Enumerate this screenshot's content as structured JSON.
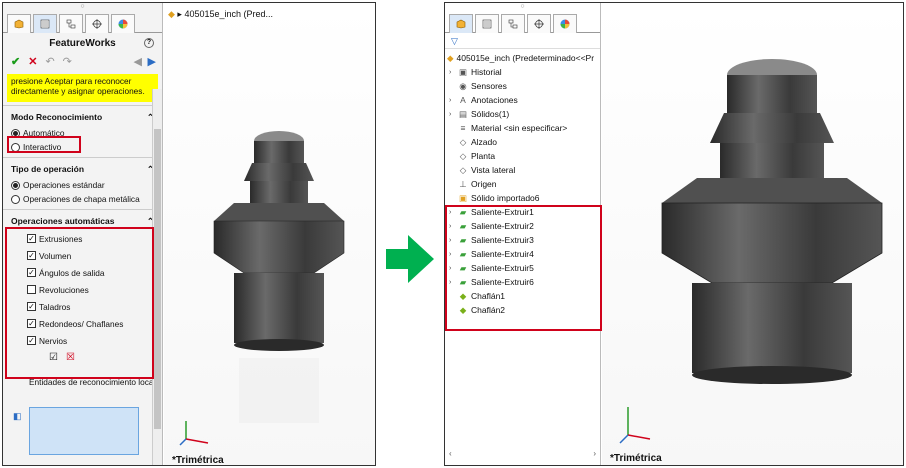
{
  "left": {
    "header_file": "405015e_inch  (Pred...",
    "feature_title": "FeatureWorks",
    "note_text": "presione Aceptar para reconocer directamente y asignar operaciones.",
    "recognition_mode": {
      "heading": "Modo Reconocimiento",
      "options": [
        "Automático",
        "Interactivo"
      ],
      "selected": "Automático"
    },
    "operation_type": {
      "heading": "Tipo de operación",
      "options": [
        "Operaciones estándar",
        "Operaciones de chapa metálica"
      ],
      "selected": "Operaciones estándar"
    },
    "auto_ops": {
      "heading": "Operaciones automáticas",
      "items": [
        {
          "label": "Extrusiones",
          "checked": true
        },
        {
          "label": "Volumen",
          "checked": true
        },
        {
          "label": "Ángulos de salida",
          "checked": true
        },
        {
          "label": "Revoluciones",
          "checked": false
        },
        {
          "label": "Taladros",
          "checked": true
        },
        {
          "label": "Redondeos/ Chaflanes",
          "checked": true
        },
        {
          "label": "Nervios",
          "checked": true
        }
      ]
    },
    "local_recognition_label": "Entidades de reconocimiento local:",
    "view_label": "*Trimétrica"
  },
  "right": {
    "root": "405015e_inch  (Predeterminado<<Pr",
    "tree": [
      {
        "label": "Historial",
        "icon": "folder-icon",
        "expandable": true
      },
      {
        "label": "Sensores",
        "icon": "sensor-icon",
        "expandable": false
      },
      {
        "label": "Anotaciones",
        "icon": "annotation-icon",
        "expandable": true
      },
      {
        "label": "Sólidos(1)",
        "icon": "solid-icon",
        "expandable": true
      },
      {
        "label": "Material <sin especificar>",
        "icon": "material-icon",
        "expandable": false
      },
      {
        "label": "Alzado",
        "icon": "plane-icon",
        "expandable": false
      },
      {
        "label": "Planta",
        "icon": "plane-icon",
        "expandable": false
      },
      {
        "label": "Vista lateral",
        "icon": "plane-icon",
        "expandable": false
      },
      {
        "label": "Origen",
        "icon": "origin-icon",
        "expandable": false
      }
    ],
    "features": [
      {
        "label": "Sólido importado6",
        "icon": "import-icon",
        "expandable": false
      },
      {
        "label": "Saliente-Extruir1",
        "icon": "extrude-icon",
        "expandable": true
      },
      {
        "label": "Saliente-Extruir2",
        "icon": "extrude-icon",
        "expandable": true
      },
      {
        "label": "Saliente-Extruir3",
        "icon": "extrude-icon",
        "expandable": true
      },
      {
        "label": "Saliente-Extruir4",
        "icon": "extrude-icon",
        "expandable": true
      },
      {
        "label": "Saliente-Extruir5",
        "icon": "extrude-icon",
        "expandable": true
      },
      {
        "label": "Saliente-Extruir6",
        "icon": "extrude-icon",
        "expandable": true
      },
      {
        "label": "Chaflán1",
        "icon": "chamfer-icon",
        "expandable": false
      },
      {
        "label": "Chaflán2",
        "icon": "chamfer-icon",
        "expandable": false
      }
    ],
    "view_label": "*Trimétrica"
  },
  "colors": {
    "highlight": "#d0021b",
    "arrow": "#00b050",
    "note": "#ffff00"
  }
}
